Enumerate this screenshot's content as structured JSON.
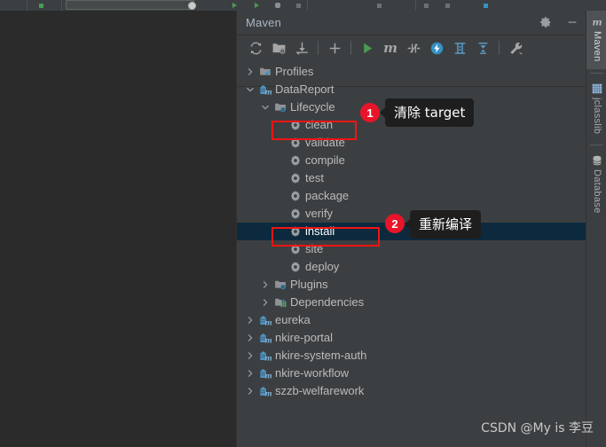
{
  "top_strip": {
    "label": ""
  },
  "panel": {
    "title": "Maven",
    "header_actions": [
      {
        "name": "settings-gear-icon",
        "label": "Settings"
      },
      {
        "name": "hide-minimize-icon",
        "label": "Hide"
      }
    ],
    "toolbar": [
      {
        "name": "reload-projects-button",
        "label": "Reload All Maven Projects"
      },
      {
        "name": "generate-sources-button",
        "label": "Generate Sources and Update Folders"
      },
      {
        "name": "download-sources-button",
        "label": "Download Sources and/or Documentation"
      },
      {
        "name": "add-maven-project-button",
        "label": "Add Maven Projects"
      },
      {
        "name": "run-maven-build-button",
        "label": "Run Maven Build"
      },
      {
        "name": "execute-maven-goal-button",
        "label": "Execute Maven Goal"
      },
      {
        "name": "toggle-offline-mode-button",
        "label": "Toggle Offline Mode"
      },
      {
        "name": "toggle-skip-tests-button",
        "label": "Toggle 'Skip Tests' Mode"
      },
      {
        "name": "show-dependencies-button",
        "label": "Show Dependencies"
      },
      {
        "name": "collapse-all-button",
        "label": "Collapse All"
      },
      {
        "name": "maven-settings-button",
        "label": "Maven Settings"
      }
    ]
  },
  "tree": {
    "rows": [
      {
        "label": "Profiles",
        "icon": "profiles-folder-icon",
        "indent": 0,
        "arrow": "collapsed",
        "selected": false
      },
      {
        "label": "DataReport",
        "icon": "maven-module-icon",
        "indent": 0,
        "arrow": "expanded",
        "selected": false
      },
      {
        "label": "Lifecycle",
        "icon": "lifecycle-folder-icon",
        "indent": 1,
        "arrow": "expanded",
        "selected": false
      },
      {
        "label": "clean",
        "icon": "maven-goal-gear-icon",
        "indent": 2,
        "arrow": "none",
        "selected": false
      },
      {
        "label": "validate",
        "icon": "maven-goal-gear-icon",
        "indent": 2,
        "arrow": "none",
        "selected": false
      },
      {
        "label": "compile",
        "icon": "maven-goal-gear-icon",
        "indent": 2,
        "arrow": "none",
        "selected": false
      },
      {
        "label": "test",
        "icon": "maven-goal-gear-icon",
        "indent": 2,
        "arrow": "none",
        "selected": false
      },
      {
        "label": "package",
        "icon": "maven-goal-gear-icon",
        "indent": 2,
        "arrow": "none",
        "selected": false
      },
      {
        "label": "verify",
        "icon": "maven-goal-gear-icon",
        "indent": 2,
        "arrow": "none",
        "selected": false
      },
      {
        "label": "install",
        "icon": "maven-goal-gear-icon",
        "indent": 2,
        "arrow": "none",
        "selected": true
      },
      {
        "label": "site",
        "icon": "maven-goal-gear-icon",
        "indent": 2,
        "arrow": "none",
        "selected": false
      },
      {
        "label": "deploy",
        "icon": "maven-goal-gear-icon",
        "indent": 2,
        "arrow": "none",
        "selected": false
      },
      {
        "label": "Plugins",
        "icon": "plugins-folder-icon",
        "indent": 1,
        "arrow": "collapsed",
        "selected": false
      },
      {
        "label": "Dependencies",
        "icon": "dependencies-icon",
        "indent": 1,
        "arrow": "collapsed",
        "selected": false
      },
      {
        "label": "eureka",
        "icon": "maven-module-icon",
        "indent": 0,
        "arrow": "collapsed",
        "selected": false
      },
      {
        "label": "nkire-portal",
        "icon": "maven-module-icon",
        "indent": 0,
        "arrow": "collapsed",
        "selected": false
      },
      {
        "label": "nkire-system-auth",
        "icon": "maven-module-icon",
        "indent": 0,
        "arrow": "collapsed",
        "selected": false
      },
      {
        "label": "nkire-workflow",
        "icon": "maven-module-icon",
        "indent": 0,
        "arrow": "collapsed",
        "selected": false
      },
      {
        "label": "szzb-welfarework",
        "icon": "maven-module-icon",
        "indent": 0,
        "arrow": "collapsed",
        "selected": false
      }
    ]
  },
  "annotations": [
    {
      "badge": "1",
      "tooltip": "清除 target",
      "target": "clean"
    },
    {
      "badge": "2",
      "tooltip": "重新编译",
      "target": "install"
    }
  ],
  "right_tabs": [
    {
      "label": "Maven",
      "icon": "maven-m-icon",
      "active": true
    },
    {
      "label": "jclasslib",
      "icon": "jclasslib-icon",
      "active": false
    },
    {
      "label": "Database",
      "icon": "database-icon",
      "active": false
    }
  ],
  "watermark": {
    "text": "CSDN @My is 李豆"
  },
  "colors": {
    "panel_bg": "#3c3f41",
    "editor_bg": "#2b2b2b",
    "selection_bg": "#0d293e",
    "text": "#bbbbbb",
    "accent_red": "#f21414",
    "badge_red": "#e8152a",
    "tooltip_bg": "#1e1e1e",
    "icon_blue": "#3592c4",
    "run_green": "#499c54"
  }
}
